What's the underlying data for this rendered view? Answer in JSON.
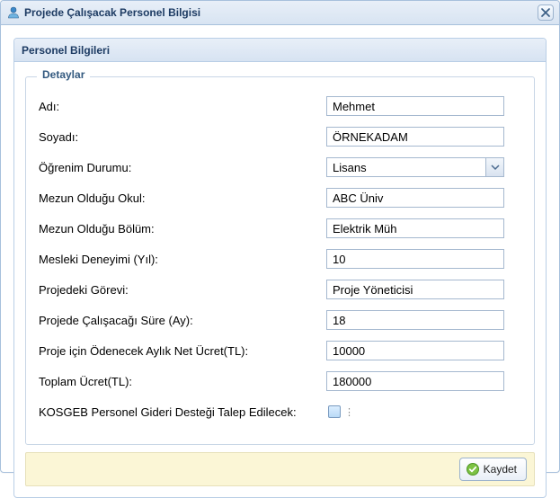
{
  "window": {
    "title": "Projede Çalışacak Personel Bilgisi"
  },
  "panel": {
    "title": "Personel Bilgileri",
    "fieldset_legend": "Detaylar"
  },
  "fields": {
    "name": {
      "label": "Adı:",
      "value": "Mehmet"
    },
    "surname": {
      "label": "Soyadı:",
      "value": "ÖRNEKADAM"
    },
    "education": {
      "label": "Öğrenim Durumu:",
      "value": "Lisans"
    },
    "school": {
      "label": "Mezun Olduğu Okul:",
      "value": "ABC Üniv"
    },
    "department": {
      "label": "Mezun Olduğu Bölüm:",
      "value": "Elektrik Müh"
    },
    "experience": {
      "label": "Mesleki Deneyimi (Yıl):",
      "value": "10"
    },
    "role": {
      "label": "Projedeki Görevi:",
      "value": "Proje Yöneticisi"
    },
    "duration": {
      "label": "Projede Çalışacağı Süre (Ay):",
      "value": "18"
    },
    "monthly": {
      "label": "Proje için Ödenecek Aylık Net Ücret(TL):",
      "value": "10000"
    },
    "total": {
      "label": "Toplam Ücret(TL):",
      "value": "180000"
    },
    "kosgeb": {
      "label": "KOSGEB Personel Gideri Desteği Talep Edilecek:",
      "checked": false
    }
  },
  "actions": {
    "save": "Kaydet"
  }
}
